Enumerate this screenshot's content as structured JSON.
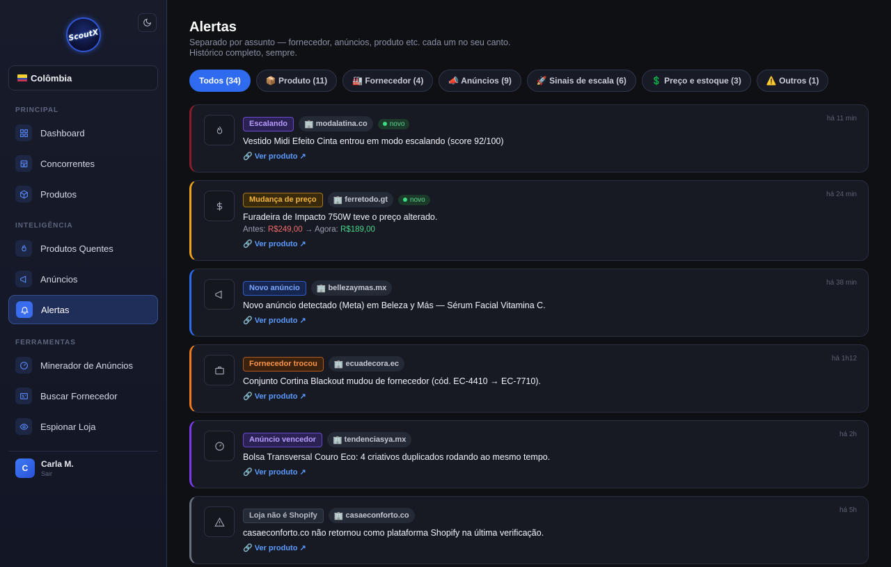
{
  "app": {
    "logo_text": "ScoutX"
  },
  "sidebar": {
    "country": "Colômbia",
    "sections": {
      "principal": "PRINCIPAL",
      "inteligencia": "INTELIGÊNCIA",
      "ferramentas": "FERRAMENTAS"
    },
    "items": [
      {
        "label": "Dashboard",
        "icon": "grid-icon"
      },
      {
        "label": "Concorrentes",
        "icon": "store-icon"
      },
      {
        "label": "Produtos",
        "icon": "box-icon"
      },
      {
        "label": "Produtos Quentes",
        "icon": "flame-icon"
      },
      {
        "label": "Anúncios",
        "icon": "megaphone-icon"
      },
      {
        "label": "Alertas",
        "icon": "bell-icon"
      },
      {
        "label": "Minerador de Anúncios",
        "icon": "gauge-icon"
      },
      {
        "label": "Buscar Fornecedor",
        "icon": "id-card-icon"
      },
      {
        "label": "Espionar Loja",
        "icon": "eye-icon"
      }
    ],
    "user": {
      "initial": "C",
      "name": "Carla M.",
      "logout": "Sair"
    }
  },
  "main": {
    "title": "Alertas",
    "subtitle": "Separado por assunto — fornecedor, anúncios, produto etc. cada um no seu canto. Histórico completo, sempre.",
    "tabs": [
      {
        "label": "Todos (34)"
      },
      {
        "label": "📦 Produto (11)"
      },
      {
        "label": "🏭 Fornecedor (4)"
      },
      {
        "label": "📣 Anúncios (9)"
      },
      {
        "label": "🚀 Sinais de escala (6)"
      },
      {
        "label": "💲 Preço e estoque (3)"
      },
      {
        "label": "⚠️ Outros (1)"
      }
    ],
    "novo_label": "novo",
    "link_label": "Ver produto ↗",
    "price_labels": {
      "before": "Antes:",
      "arrow": "→",
      "after": "Agora:"
    },
    "alerts": [
      {
        "badge": "Escalando",
        "store": "modalatina.co",
        "is_new": true,
        "message": "Vestido Midi Efeito Cinta entrou em modo escalando (score 92/100)",
        "time": "há 11 min",
        "icon": "flame-icon",
        "accent": "#8b1e2a"
      },
      {
        "badge": "Mudança de preço",
        "store": "ferretodo.gt",
        "is_new": true,
        "message": "Furadeira de Impacto 750W teve o preço alterado.",
        "old_price": "R$249,00",
        "new_price": "R$189,00",
        "time": "há 24 min",
        "icon": "dollar-icon",
        "accent": "#f0a416"
      },
      {
        "badge": "Novo anúncio",
        "store": "bellezaymas.mx",
        "is_new": false,
        "message": "Novo anúncio detectado (Meta) em Beleza y Más — Sérum Facial Vitamina C.",
        "time": "há 38 min",
        "icon": "megaphone-icon",
        "accent": "#2f6bef"
      },
      {
        "badge": "Fornecedor trocou",
        "store": "ecuadecora.ec",
        "is_new": false,
        "message": "Conjunto Cortina Blackout mudou de fornecedor (cód. EC-4410 → EC-7710).",
        "time": "há 1h12",
        "icon": "briefcase-icon",
        "accent": "#f27a1a"
      },
      {
        "badge": "Anúncio vencedor",
        "store": "tendenciasya.mx",
        "is_new": false,
        "message": "Bolsa Transversal Couro Eco: 4 criativos duplicados rodando ao mesmo tempo.",
        "time": "há 2h",
        "icon": "gauge-icon",
        "accent": "#7c3aed"
      },
      {
        "badge": "Loja não é Shopify",
        "store": "casaeconforto.co",
        "is_new": false,
        "message": "casaeconforto.co não retornou como plataforma Shopify na última verificação.",
        "time": "há 5h",
        "icon": "warning-icon",
        "accent": "#6b7080"
      }
    ]
  }
}
